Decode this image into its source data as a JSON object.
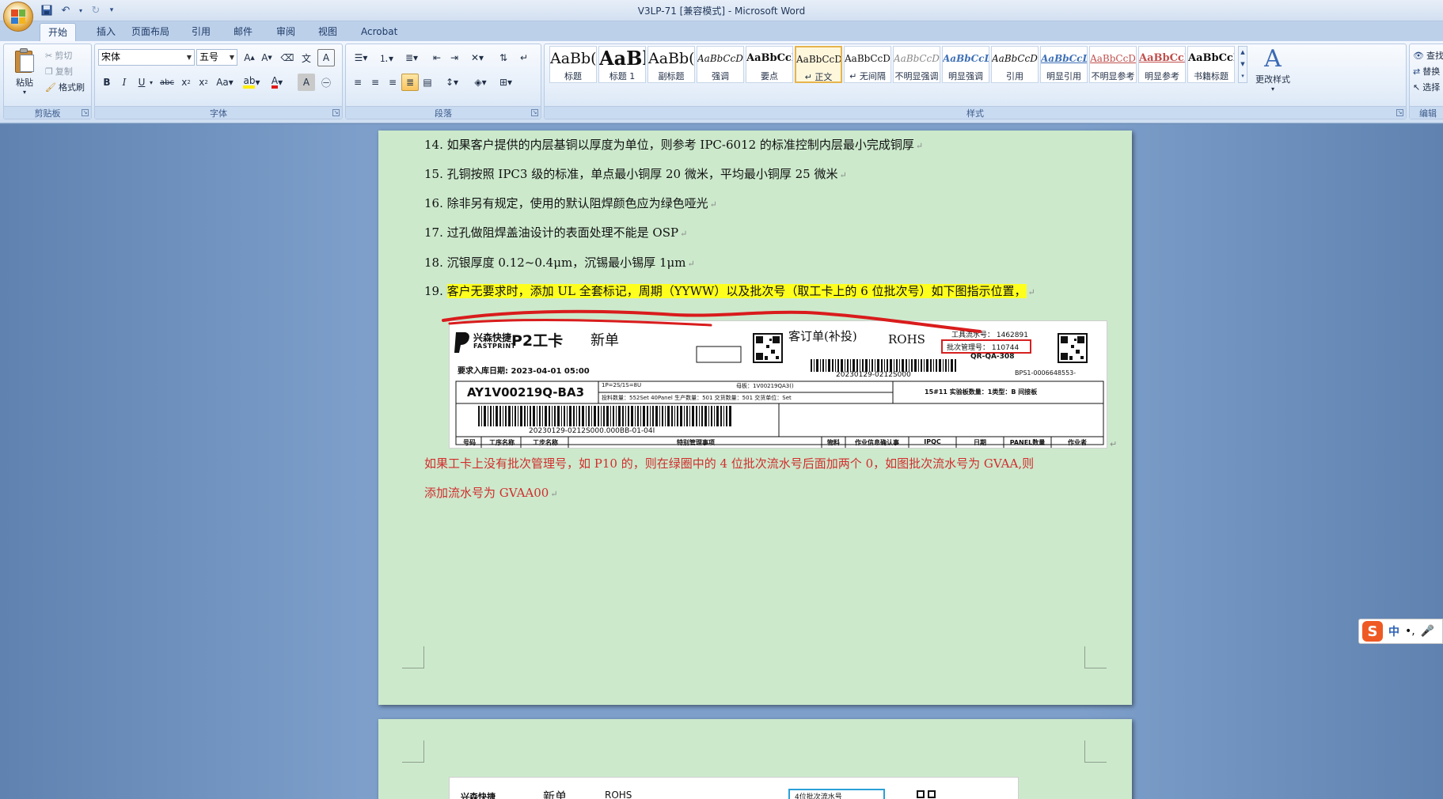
{
  "window": {
    "title": "V3LP-71 [兼容模式] - Microsoft Word"
  },
  "tabs": [
    "开始",
    "插入",
    "页面布局",
    "引用",
    "邮件",
    "审阅",
    "视图",
    "Acrobat"
  ],
  "clipboard": {
    "paste": "粘贴",
    "cut": "剪切",
    "copy": "复制",
    "format_painter": "格式刷",
    "group": "剪贴板"
  },
  "font": {
    "name": "宋体",
    "size": "五号",
    "group": "字体"
  },
  "paragraph": {
    "group": "段落"
  },
  "styles": {
    "group": "样式",
    "change_styles": "更改样式",
    "items": [
      {
        "preview": "AaBb(",
        "name": "标题"
      },
      {
        "preview": "AaBl",
        "name": "标题 1"
      },
      {
        "preview": "AaBb(",
        "name": "副标题"
      },
      {
        "preview": "AaBbCcDd",
        "name": "强调"
      },
      {
        "preview": "AaBbCcD",
        "name": "要点"
      },
      {
        "preview": "AaBbCcDd",
        "name": "↵ 正文"
      },
      {
        "preview": "AaBbCcDd",
        "name": "↵ 无间隔"
      },
      {
        "preview": "AaBbCcDd",
        "name": "不明显强调"
      },
      {
        "preview": "AaBbCcDd",
        "name": "明显强调"
      },
      {
        "preview": "AaBbCcDd",
        "name": "引用"
      },
      {
        "preview": "AaBbCcDd",
        "name": "明显引用"
      },
      {
        "preview": "AaBbCcD",
        "name": "不明显参考"
      },
      {
        "preview": "AaBbCcI",
        "name": "明显参考"
      },
      {
        "preview": "AaBbCcI",
        "name": "书籍标题"
      }
    ]
  },
  "editing": {
    "find": "查找",
    "replace": "替换",
    "select": "选择",
    "group": "编辑"
  },
  "document": {
    "lines": [
      "14. 如果客户提供的内层基铜以厚度为单位，则参考 IPC-6012 的标准控制内层最小完成铜厚",
      "15. 孔铜按照 IPC3 级的标准，单点最小铜厚 20 微米，平均最小铜厚 25 微米",
      "16. 除非另有规定，使用的默认阻焊颜色应为绿色哑光",
      "17. 过孔做阻焊盖油设计的表面处理不能是 OSP",
      "18. 沉银厚度 0.12~0.4μm，沉锡最小锡厚 1μm"
    ],
    "line19_num": "19.",
    "line19_text": "客户无要求时，添加 UL 全套标记，周期（YYWW）以及批次号（取工卡上的 6 位批次号）如下图指示位置，",
    "red_note_1": "如果工卡上没有批次管理号，如 P10 的，则在绿圈中的 4 位批次流水号后面加两个 0，如图批次流水号为 GVAA,则",
    "red_note_2": "添加流水号为 GVAA00"
  },
  "card": {
    "brand_cn": "兴森快捷",
    "brand_en": "FASTPRINT",
    "card_type": "P2工卡",
    "order_state": "新单",
    "order_name": "客订单(补投)",
    "rohs": "ROHS",
    "tool_no": "工具流水号： 1462891",
    "batch_no": "批次管理号： 110744",
    "qr_code": "QR-QA-308",
    "barcode_top": "20230129-0212S000",
    "doc_code": "BPS1-0006648553-",
    "required_date": "要求入库日期:   2023-04-01 05:00",
    "part_no": "AY1V00219Q-BA3",
    "spec_1": "1P=2S/1S=8U",
    "spec_mother": "母板：1V00219QA3()",
    "spec_2": "投料数量：552Set   40Panel   生产数量：501   交货数量：501   交货单位：Set",
    "right_info": "15#11      实验板数量：1类型：B 间接板",
    "barcode_bottom": "20230129-0212S000.000BB-01-04I",
    "table_headers": [
      "号码",
      "工序名称",
      "工步名称",
      "特别管理事项",
      "物料",
      "作业信息确认事",
      "IPQC",
      "日期",
      "PANEL数量",
      "作业者"
    ]
  },
  "card2": {
    "brand_cn": "兴森快捷",
    "order_state": "新单",
    "rohs": "ROHS",
    "flow_label": "4位批次流水号"
  },
  "ime": {
    "lang": "中",
    "punct": "•,"
  }
}
